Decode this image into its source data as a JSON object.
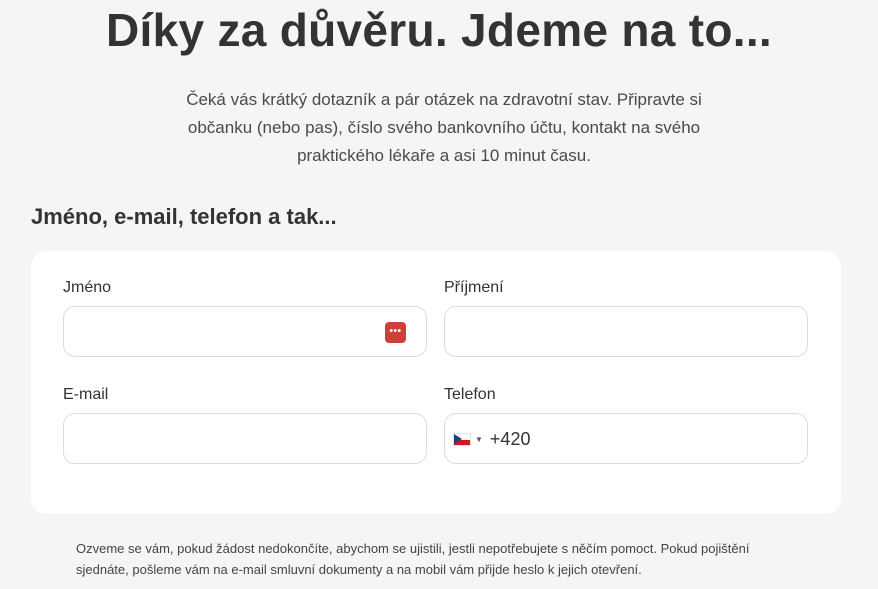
{
  "header": {
    "title": "Díky za důvěru. Jdeme na to...",
    "intro": "Čeká vás krátký dotazník a pár otázek na zdravotní stav. Připravte si občanku (nebo pas), číslo svého bankovního účtu, kontakt na svého praktického lékaře a asi 10 minut času."
  },
  "form": {
    "section_title": "Jméno, e-mail, telefon a tak...",
    "first_name": {
      "label": "Jméno",
      "value": ""
    },
    "last_name": {
      "label": "Příjmení",
      "value": ""
    },
    "email": {
      "label": "E-mail",
      "value": ""
    },
    "phone": {
      "label": "Telefon",
      "dial_code": "+420",
      "country": "CZ",
      "value": ""
    },
    "password_manager_icon": "•••"
  },
  "footnote": "Ozveme se vám, pokud žádost nedokončíte, abychom se ujistili, jestli nepotřebujete s něčím pomoct. Pokud pojištění sjednáte, pošleme vám na e-mail smluvní dokumenty a na mobil vám přijde heslo k jejich otevření.",
  "colors": {
    "background": "#f5f5f5",
    "card": "#ffffff",
    "password_icon": "#d0403b",
    "input_border": "#dcdcdc"
  }
}
